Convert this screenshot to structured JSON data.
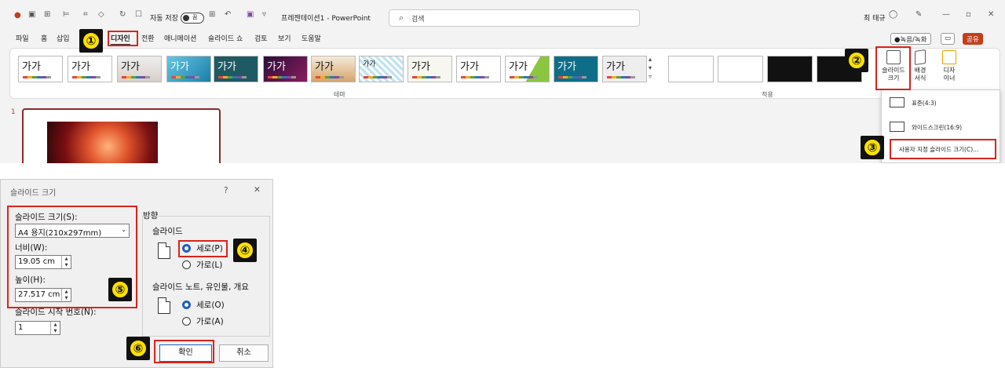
{
  "titlebar": {
    "autosave_label": "자동 저장",
    "autosave_state": "끔",
    "doc_title": "프레젠테이션1 - PowerPoint",
    "search_placeholder": "검색",
    "user_name": "최 태규"
  },
  "menu_tabs": [
    "파일",
    "홈",
    "삽입",
    "디자인",
    "전환",
    "애니메이션",
    "슬라이드 쇼",
    "검토",
    "보기",
    "도움말"
  ],
  "active_tab": "디자인",
  "top_right": {
    "record": "●녹음/녹화",
    "share": "공유"
  },
  "ribbon": {
    "theme_sample_text": "가가",
    "group_theme": "테마",
    "group_variants": "적용",
    "slide_size_button": "슬라이드\n크기",
    "format_bg_button": "배경\n서식",
    "designer_button": "디자\n이너"
  },
  "slide_size_menu": {
    "items": [
      "표준(4:3)",
      "와이드스크린(16:9)",
      "사용자 지정 슬라이드 크기(C)..."
    ]
  },
  "slide_panel": {
    "slide_number": "1"
  },
  "dialog": {
    "title": "슬라이드 크기",
    "help": "?",
    "close": "✕",
    "size_label": "슬라이드 크기(S):",
    "size_value": "A4 용지(210x297mm)",
    "width_label": "너비(W):",
    "width_value": "19.05 cm",
    "height_label": "높이(H):",
    "height_value": "27.517 cm",
    "start_number_label": "슬라이드 시작 번호(N):",
    "start_number_value": "1",
    "orientation_label": "방향",
    "slides_label": "슬라이드",
    "portrait_label": "세로(P)",
    "landscape_label": "가로(L)",
    "notes_label": "슬라이드 노트, 유인물, 개요",
    "notes_portrait": "세로(O)",
    "notes_landscape": "가로(A)",
    "ok": "확인",
    "cancel": "취소"
  },
  "step_markers": [
    "①",
    "②",
    "③",
    "④",
    "⑤",
    "⑥"
  ],
  "colors": {
    "highlight": "#d9241c",
    "marker_fill": "#ffe100",
    "accent": "#c43e1c"
  }
}
